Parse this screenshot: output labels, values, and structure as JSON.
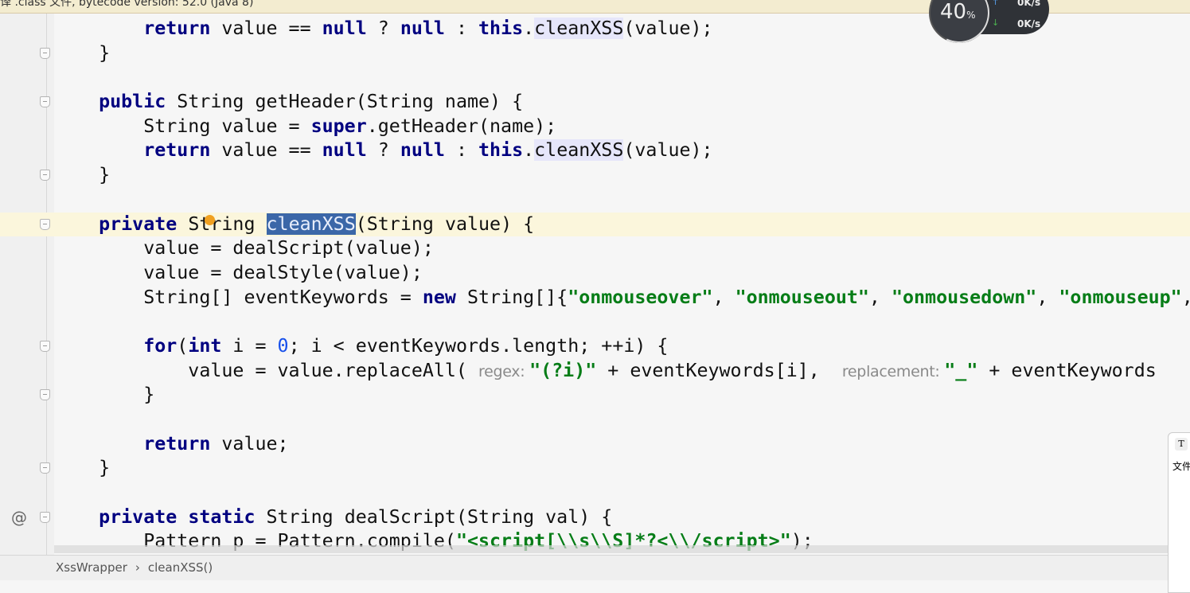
{
  "banner": {
    "text": "译 .class 文件, bytecode version: 52.0 (Java 8)"
  },
  "monitor": {
    "cpu_percent": "40",
    "percent_sign": "%",
    "upload": "0K/s",
    "download": "0K/s"
  },
  "colors": {
    "keyword": "#000080",
    "string": "#067d17",
    "selection": "#3b67a8",
    "caret_line": "#fbf6dc"
  },
  "editor": {
    "lines": [
      {
        "fold": false,
        "tokens": [
          [
            "",
            "        "
          ],
          [
            "k",
            "return"
          ],
          [
            "",
            " value == "
          ],
          [
            "k",
            "null"
          ],
          [
            "",
            " ? "
          ],
          [
            "k",
            "null"
          ],
          [
            "",
            " : "
          ],
          [
            "k",
            "this"
          ],
          [
            "",
            "."
          ],
          [
            "u",
            "cleanXSS"
          ],
          [
            "",
            "(value);"
          ]
        ]
      },
      {
        "fold": true,
        "tokens": [
          [
            "",
            "    }"
          ]
        ]
      },
      {
        "fold": false,
        "tokens": []
      },
      {
        "fold": true,
        "tokens": [
          [
            "",
            "    "
          ],
          [
            "k",
            "public"
          ],
          [
            "",
            " String getHeader(String name) {"
          ]
        ]
      },
      {
        "fold": false,
        "tokens": [
          [
            "",
            "        String value = "
          ],
          [
            "k",
            "super"
          ],
          [
            "",
            ".getHeader(name);"
          ]
        ]
      },
      {
        "fold": false,
        "tokens": [
          [
            "",
            "        "
          ],
          [
            "k",
            "return"
          ],
          [
            "",
            " value == "
          ],
          [
            "k",
            "null"
          ],
          [
            "",
            " ? "
          ],
          [
            "k",
            "null"
          ],
          [
            "",
            " : "
          ],
          [
            "k",
            "this"
          ],
          [
            "",
            "."
          ],
          [
            "u",
            "cleanXSS"
          ],
          [
            "",
            "(value);"
          ]
        ]
      },
      {
        "fold": true,
        "tokens": [
          [
            "",
            "    }"
          ]
        ]
      },
      {
        "fold": false,
        "tokens": []
      },
      {
        "fold": true,
        "caret": true,
        "tokens": [
          [
            "",
            "    "
          ],
          [
            "k",
            "private"
          ],
          [
            "",
            " String "
          ],
          [
            "sel",
            "cleanXSS"
          ],
          [
            "",
            "(String value) {"
          ]
        ]
      },
      {
        "fold": false,
        "tokens": [
          [
            "",
            "        value = dealScript(value);"
          ]
        ]
      },
      {
        "fold": false,
        "tokens": [
          [
            "",
            "        value = dealStyle(value);"
          ]
        ]
      },
      {
        "fold": false,
        "tokens": [
          [
            "",
            "        String[] eventKeywords = "
          ],
          [
            "k",
            "new"
          ],
          [
            "",
            " String[]{"
          ],
          [
            "s",
            "\"onmouseover\""
          ],
          [
            "",
            ", "
          ],
          [
            "s",
            "\"onmouseout\""
          ],
          [
            "",
            ", "
          ],
          [
            "s",
            "\"onmousedown\""
          ],
          [
            "",
            ", "
          ],
          [
            "s",
            "\"onmouseup\""
          ],
          [
            "",
            ","
          ]
        ]
      },
      {
        "fold": false,
        "tokens": []
      },
      {
        "fold": true,
        "tokens": [
          [
            "",
            "        "
          ],
          [
            "k",
            "for"
          ],
          [
            "",
            "("
          ],
          [
            "k",
            "int"
          ],
          [
            "",
            " i = "
          ],
          [
            "n",
            "0"
          ],
          [
            "",
            "; i < eventKeywords.length; ++i) {"
          ]
        ]
      },
      {
        "fold": false,
        "tokens": [
          [
            "",
            "            value = value.replaceAll( "
          ],
          [
            "h",
            "regex: "
          ],
          [
            "s",
            "\"(?i)\""
          ],
          [
            "",
            " + eventKeywords[i],  "
          ],
          [
            "h",
            "replacement: "
          ],
          [
            "s",
            "\"_\""
          ],
          [
            "",
            " + eventKeywords"
          ]
        ]
      },
      {
        "fold": true,
        "tokens": [
          [
            "",
            "        }"
          ]
        ]
      },
      {
        "fold": false,
        "tokens": []
      },
      {
        "fold": false,
        "tokens": [
          [
            "",
            "        "
          ],
          [
            "k",
            "return"
          ],
          [
            "",
            " value;"
          ]
        ]
      },
      {
        "fold": true,
        "tokens": [
          [
            "",
            "    }"
          ]
        ]
      },
      {
        "fold": false,
        "tokens": []
      },
      {
        "fold": true,
        "at": "@",
        "tokens": [
          [
            "",
            "    "
          ],
          [
            "k",
            "private static"
          ],
          [
            "",
            " String dealScript(String val) {"
          ]
        ]
      },
      {
        "fold": false,
        "tokens": [
          [
            "",
            "        Pattern p = Pattern.compile("
          ],
          [
            "s",
            "\"<script[\\\\s\\\\S]*?<\\\\/script>\""
          ],
          [
            "",
            ");"
          ]
        ]
      }
    ]
  },
  "breadcrumb": {
    "items": [
      "XssWrapper",
      "cleanXSS()"
    ],
    "separator": "›"
  },
  "side_panel": {
    "icon_letter": "T",
    "text": "文件"
  }
}
